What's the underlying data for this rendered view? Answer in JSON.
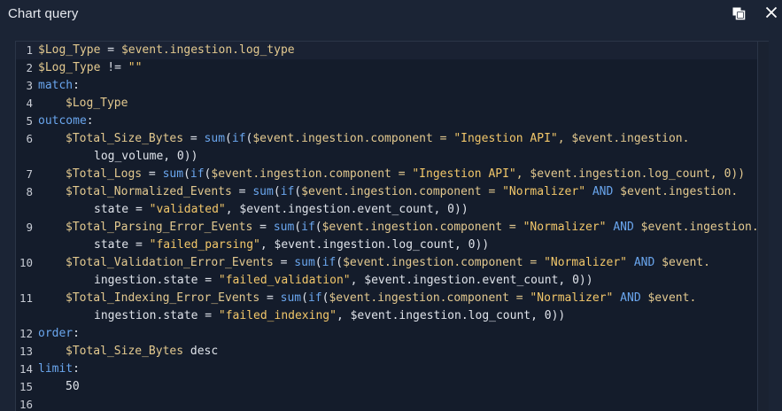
{
  "dialog": {
    "title": "Chart query",
    "copy_icon": "copy-icon",
    "close_icon": "close-icon"
  },
  "editor": {
    "line_numbers": [
      "1",
      "2",
      "3",
      "4",
      "5",
      "6",
      "7",
      "8",
      "9",
      "10",
      "11",
      "12",
      "13",
      "14",
      "15",
      "16"
    ],
    "lines": {
      "l1": {
        "a": "$Log_Type",
        "b": " = ",
        "c": "$event.ingestion.log_type"
      },
      "l2": {
        "a": "$Log_Type",
        "b": " != ",
        "c": "\"\""
      },
      "l3": {
        "kw": "match",
        "p": ":"
      },
      "l4": {
        "a": "$Log_Type"
      },
      "l5": {
        "kw": "outcome",
        "p": ":"
      },
      "l6": {
        "a": "$Total_Size_Bytes",
        "b": " = ",
        "fn1": "sum",
        "p1": "(",
        "fn2": "if",
        "p2": "(",
        "c": "$event.ingestion.component = ",
        "s": "\"Ingestion API\"",
        "d": ", $event.ingestion.",
        "cont": "log_volume, 0))"
      },
      "l7": {
        "a": "$Total_Logs",
        "b": " = ",
        "fn1": "sum",
        "p1": "(",
        "fn2": "if",
        "p2": "(",
        "c": "$event.ingestion.component = ",
        "s": "\"Ingestion API\"",
        "d": ", $event.ingestion.log_count, 0))"
      },
      "l8": {
        "a": "$Total_Normalized_Events",
        "b": " = ",
        "fn1": "sum",
        "p1": "(",
        "fn2": "if",
        "p2": "(",
        "c": "$event.ingestion.component = ",
        "s": "\"Normalizer\"",
        "k": " AND ",
        "d": "$event.ingestion.",
        "cont1": "state = ",
        "s2": "\"validated\"",
        "cont2": ", $event.ingestion.event_count, 0))"
      },
      "l9": {
        "a": "$Total_Parsing_Error_Events",
        "b": " = ",
        "fn1": "sum",
        "p1": "(",
        "fn2": "if",
        "p2": "(",
        "c": "$event.ingestion.component = ",
        "s": "\"Normalizer\"",
        "k": " AND ",
        "d": "$event.ingestion.",
        "cont1": "state = ",
        "s2": "\"failed_parsing\"",
        "cont2": ", $event.ingestion.log_count, 0))"
      },
      "l10": {
        "a": "$Total_Validation_Error_Events",
        "b": " = ",
        "fn1": "sum",
        "p1": "(",
        "fn2": "if",
        "p2": "(",
        "c": "$event.ingestion.component = ",
        "s": "\"Normalizer\"",
        "k": " AND ",
        "d": "$event.",
        "cont1": "ingestion.state = ",
        "s2": "\"failed_validation\"",
        "cont2": ", $event.ingestion.event_count, 0))"
      },
      "l11": {
        "a": "$Total_Indexing_Error_Events",
        "b": " = ",
        "fn1": "sum",
        "p1": "(",
        "fn2": "if",
        "p2": "(",
        "c": "$event.ingestion.component = ",
        "s": "\"Normalizer\"",
        "k": " AND ",
        "d": "$event.",
        "cont1": "ingestion.state = ",
        "s2": "\"failed_indexing\"",
        "cont2": ", $event.ingestion.log_count, 0))"
      },
      "l12": {
        "kw": "order",
        "p": ":"
      },
      "l13": {
        "a": "$Total_Size_Bytes",
        "b": " desc"
      },
      "l14": {
        "kw": "limit",
        "p": ":"
      },
      "l15": {
        "a": "50"
      },
      "l16": {}
    }
  },
  "colors": {
    "background": "#1b2435",
    "editor_background": "#141c2b",
    "keyword": "#6aa6ee",
    "variable": "#e3c98f",
    "string": "#f2c76a"
  }
}
